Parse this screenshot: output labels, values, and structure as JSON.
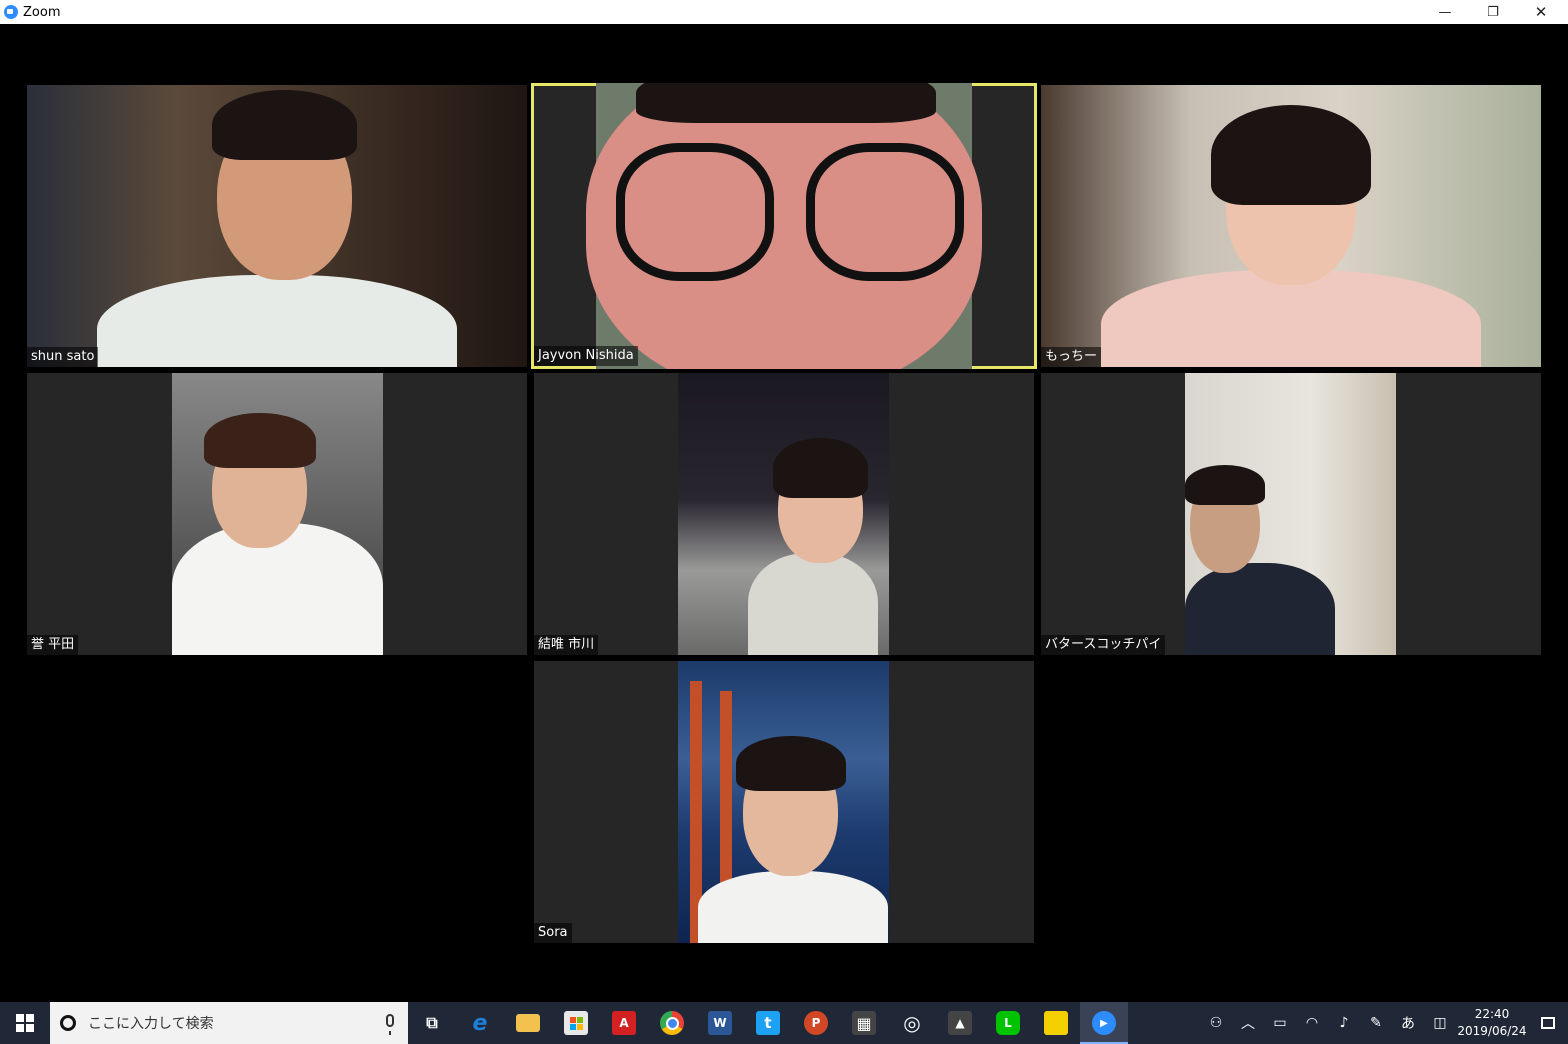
{
  "window": {
    "title": "Zoom",
    "controls": [
      "—",
      "❐",
      "✕"
    ]
  },
  "participants": [
    {
      "name": "shun sato",
      "active": false
    },
    {
      "name": "Jayvon Nishida",
      "active": true
    },
    {
      "name": "もっちー",
      "active": false
    },
    {
      "name": "誉 平田",
      "active": false
    },
    {
      "name": "結唯 市川",
      "active": false
    },
    {
      "name": "バタースコッチパイ",
      "active": false
    },
    {
      "name": "Sora",
      "active": false
    }
  ],
  "taskbar": {
    "search_placeholder": "ここに入力して検索",
    "apps": [
      {
        "icon": "task-view-icon",
        "glyph": "⧉"
      },
      {
        "icon": "edge-icon",
        "glyph": "e",
        "color": "#1e7fd6"
      },
      {
        "icon": "file-explorer-icon",
        "glyph": "",
        "color": "#f2c14e"
      },
      {
        "icon": "store-icon",
        "glyph": "",
        "color": "#e8e8e8"
      },
      {
        "icon": "acrobat-icon",
        "glyph": "A",
        "color": "#d32020"
      },
      {
        "icon": "chrome-icon",
        "glyph": "",
        "color": "#34a853"
      },
      {
        "icon": "word-icon",
        "glyph": "W",
        "color": "#2b5797"
      },
      {
        "icon": "twitter-icon",
        "glyph": "t",
        "color": "#1da1f2"
      },
      {
        "icon": "powerpoint-icon",
        "glyph": "P",
        "color": "#d24726"
      },
      {
        "icon": "calculator-icon",
        "glyph": "▦",
        "color": "#444"
      },
      {
        "icon": "groove-icon",
        "glyph": "◎",
        "color": "#202838"
      },
      {
        "icon": "photos-icon",
        "glyph": "▲",
        "color": "#444"
      },
      {
        "icon": "line-icon",
        "glyph": "L",
        "color": "#00c300"
      },
      {
        "icon": "sticky-notes-icon",
        "glyph": "",
        "color": "#f5d000"
      },
      {
        "icon": "zoom-icon",
        "glyph": "▶",
        "color": "#2d8cff",
        "active": true
      }
    ],
    "tray": {
      "ime": "あ",
      "time": "22:40",
      "date": "2019/06/24"
    }
  }
}
